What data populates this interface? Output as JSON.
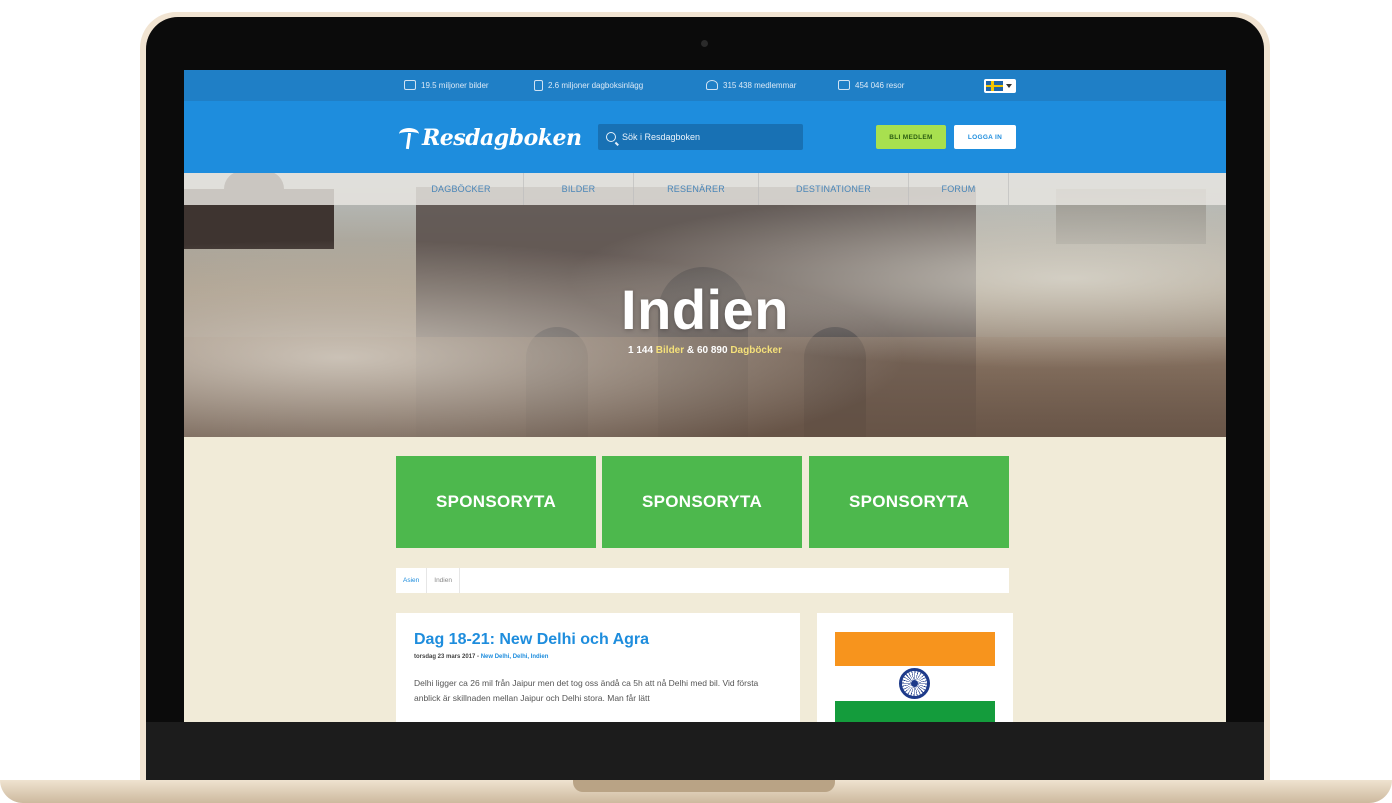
{
  "topbar": {
    "stats": [
      {
        "icon": "camera-icon",
        "text": "19.5 miljoner bilder"
      },
      {
        "icon": "document-icon",
        "text": "2.6 miljoner dagboksinlägg"
      },
      {
        "icon": "user-icon",
        "text": "315 438 medlemmar"
      },
      {
        "icon": "map-icon",
        "text": "454 046 resor"
      }
    ],
    "language_flag": "sweden-flag-icon"
  },
  "header": {
    "logo": "Resdagboken",
    "search_placeholder": "Sök i Resdagboken",
    "member_button": "BLI MEDLEM",
    "login_button": "LOGGA IN"
  },
  "nav": {
    "items": [
      "DAGBÖCKER",
      "BILDER",
      "RESENÄRER",
      "DESTINATIONER",
      "FORUM"
    ]
  },
  "hero": {
    "title": "Indien",
    "images_count": "1 144",
    "images_label": "Bilder",
    "joiner": "&",
    "diaries_count": "60 890",
    "diaries_label": "Dagböcker"
  },
  "sponsors": [
    "SPONSORYTA",
    "SPONSORYTA",
    "SPONSORYTA"
  ],
  "breadcrumb": {
    "items": [
      "Asien",
      "Indien"
    ]
  },
  "post": {
    "title": "Dag 18-21: New Delhi och Agra",
    "date": "torsdag 23 mars 2017 -",
    "tags": "New Delhi, Delhi, Indien",
    "body": "Delhi ligger ca 26 mil från Jaipur men det tog oss ändå ca 5h att nå Delhi med bil. Vid första anblick är skillnaden mellan Jaipur och Delhi stora. Man får lätt"
  },
  "colors": {
    "topbar": "#1f7fc6",
    "header": "#1e8ddd",
    "sponsor": "#4db84d",
    "page_bg": "#f1ebd8",
    "member_button": "#a8e04f"
  }
}
